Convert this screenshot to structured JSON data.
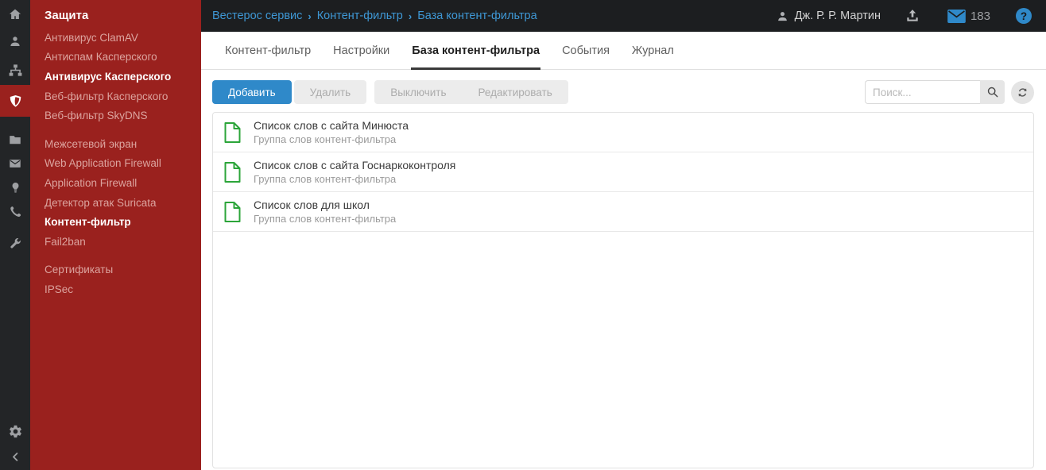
{
  "colors": {
    "sidebar_red": "#9a211e",
    "rail_dark": "#232527",
    "topbar_dark": "#1c1e20",
    "accent_blue": "#2f89c9",
    "breadcrumb_blue": "#3e97d4",
    "file_icon_green": "#2ca53a"
  },
  "rail": {
    "icons": [
      "home",
      "user",
      "sitemap",
      "shield",
      "folder",
      "envelope",
      "lightbulb",
      "phone",
      "wrench"
    ],
    "active_icon": "shield",
    "bottom_icons": [
      "gear",
      "collapse-left"
    ]
  },
  "sidebar": {
    "header": "Защита",
    "items": [
      {
        "label": "Антивирус ClamAV",
        "emphasis": false
      },
      {
        "label": "Антиспам Касперского",
        "emphasis": false
      },
      {
        "label": "Антивирус Касперского",
        "emphasis": true
      },
      {
        "label": "Веб-фильтр Касперского",
        "emphasis": false
      },
      {
        "label": "Веб-фильтр SkyDNS",
        "emphasis": false
      },
      {
        "label": "Межсетевой экран",
        "emphasis": false
      },
      {
        "label": "Web Application Firewall",
        "emphasis": false
      },
      {
        "label": "Application Firewall",
        "emphasis": false
      },
      {
        "label": "Детектор атак Suricata",
        "emphasis": false
      },
      {
        "label": "Контент-фильтр",
        "emphasis": true
      },
      {
        "label": "Fail2ban",
        "emphasis": false
      },
      {
        "label": "Сертификаты",
        "emphasis": false
      },
      {
        "label": "IPSec",
        "emphasis": false
      }
    ]
  },
  "topbar": {
    "breadcrumb": [
      "Вестерос сервис",
      "Контент-фильтр",
      "База контент-фильтра"
    ],
    "breadcrumb_separator": "›",
    "user_name": "Дж. Р. Р. Мартин",
    "mail_count": "183",
    "help_glyph": "?"
  },
  "tabs": {
    "items": [
      {
        "label": "Контент-фильтр"
      },
      {
        "label": "Настройки"
      },
      {
        "label": "База контент-фильтра"
      },
      {
        "label": "События"
      },
      {
        "label": "Журнал"
      }
    ],
    "active_index": 2
  },
  "toolbar": {
    "add_label": "Добавить",
    "delete_label": "Удалить",
    "disable_label": "Выключить",
    "edit_label": "Редактировать",
    "search_placeholder": "Поиск..."
  },
  "list": {
    "items": [
      {
        "title": "Список слов с сайта Минюста",
        "subtitle": "Группа слов контент-фильтра"
      },
      {
        "title": "Список слов с сайта Госнаркоконтроля",
        "subtitle": "Группа слов контент-фильтра"
      },
      {
        "title": "Список слов для школ",
        "subtitle": "Группа слов контент-фильтра"
      }
    ]
  }
}
